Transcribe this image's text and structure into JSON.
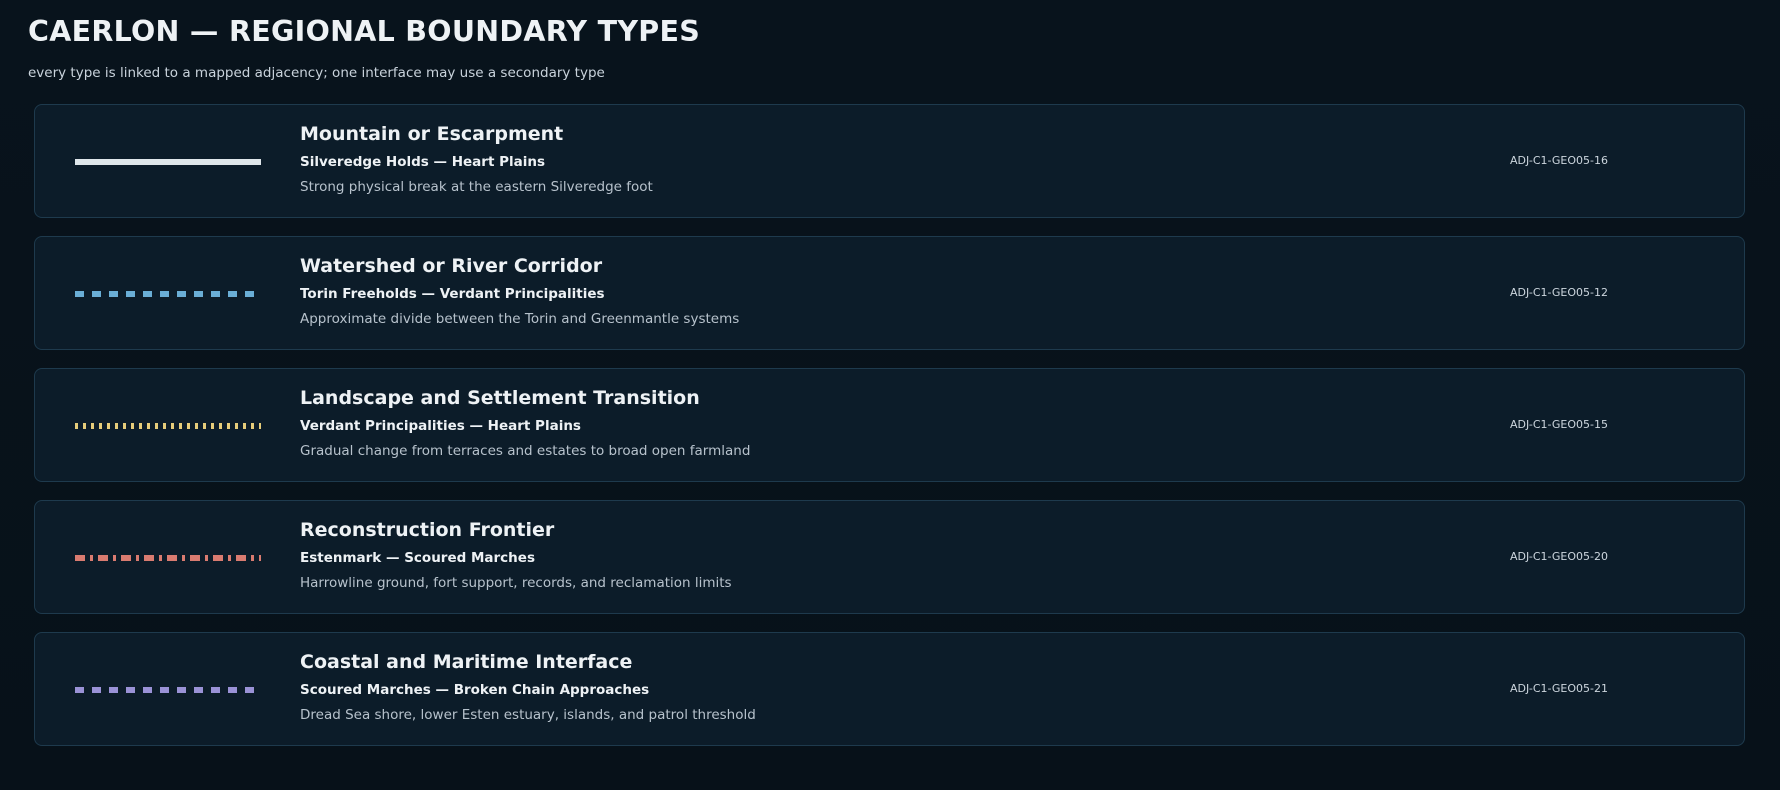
{
  "header": {
    "title": "CAERLON — REGIONAL BOUNDARY TYPES",
    "subtitle": "every type is linked to a mapped adjacency; one interface may use a secondary type"
  },
  "boundaries": [
    {
      "title": "Mountain or Escarpment",
      "link": "Silveredge Holds — Heart Plains",
      "description": "Strong physical break at the eastern Silveredge foot",
      "code": "ADJ-C1-GEO05-16",
      "line_style": "solid",
      "color": "#dfe6ea"
    },
    {
      "title": "Watershed or River Corridor",
      "link": "Torin Freeholds — Verdant Principalities",
      "description": "Approximate divide between the Torin and Greenmantle systems",
      "code": "ADJ-C1-GEO05-12",
      "line_style": "dashed",
      "color": "#6aaed6"
    },
    {
      "title": "Landscape and Settlement Transition",
      "link": "Verdant Principalities — Heart Plains",
      "description": "Gradual change from terraces and estates to broad open farmland",
      "code": "ADJ-C1-GEO05-15",
      "line_style": "dotted",
      "color": "#e6cc7a"
    },
    {
      "title": "Reconstruction Frontier",
      "link": "Estenmark — Scoured Marches",
      "description": "Harrowline ground, fort support, records, and reclamation limits",
      "code": "ADJ-C1-GEO05-20",
      "line_style": "dash-dot",
      "color": "#d97b70"
    },
    {
      "title": "Coastal and Maritime Interface",
      "link": "Scoured Marches — Broken Chain Approaches",
      "description": "Dread Sea shore, lower Esten estuary, islands, and patrol threshold",
      "code": "ADJ-C1-GEO05-21",
      "line_style": "dashed",
      "color": "#9a92d6"
    }
  ]
}
